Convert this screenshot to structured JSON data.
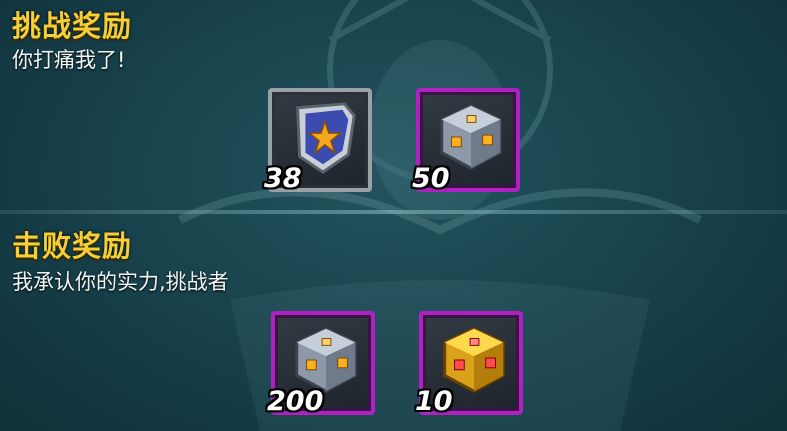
{
  "challenge": {
    "title": "挑战奖励",
    "subtitle": "你打痛我了!",
    "rewards": [
      {
        "icon": "shield-star-icon",
        "rarity": "gray",
        "qty": "38"
      },
      {
        "icon": "silver-cube-icon",
        "rarity": "purple",
        "qty": "50"
      }
    ]
  },
  "defeat": {
    "title": "击败奖励",
    "subtitle": "我承认你的实力,挑战者",
    "rewards": [
      {
        "icon": "silver-cube-icon",
        "rarity": "purple",
        "qty": "200"
      },
      {
        "icon": "gold-cube-icon",
        "rarity": "purple",
        "qty": "10"
      }
    ]
  },
  "colors": {
    "background": "#17404a",
    "title": "#f5cf35",
    "border_gray": "#9aa2a8",
    "border_purple": "#b021c4"
  }
}
